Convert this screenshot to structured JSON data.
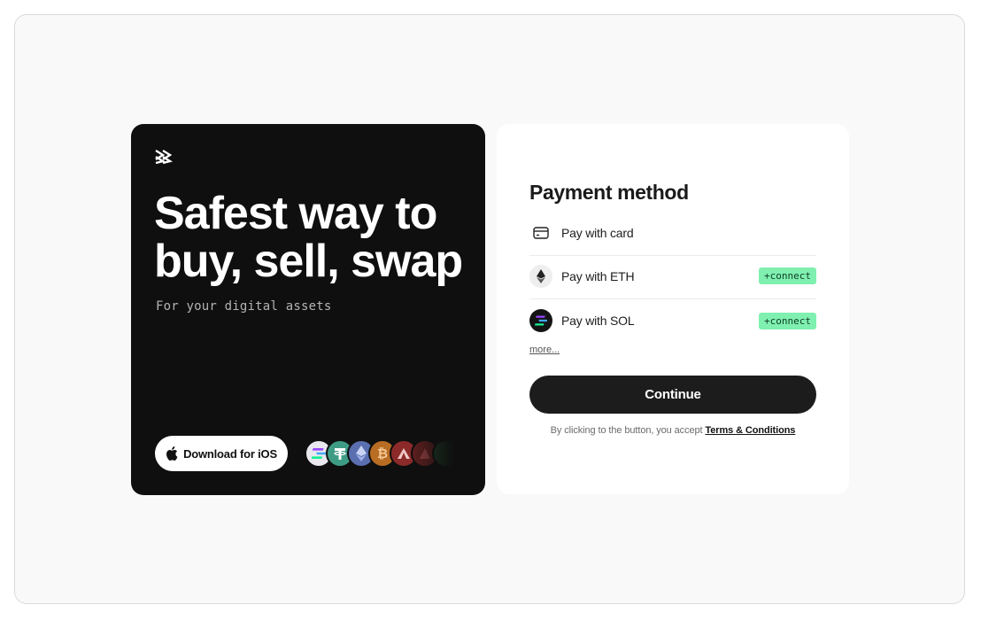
{
  "hero": {
    "title_line1": "Safest way to",
    "title_line2": "buy, sell, swap",
    "subtitle": "For your digital assets",
    "download_button_label": "Download for iOS",
    "logo_icon": "double-chevron-logo-icon",
    "coins": [
      {
        "name": "solana-icon",
        "color": "#e8e8ee"
      },
      {
        "name": "tether-icon",
        "color": "#3f9c84"
      },
      {
        "name": "ethereum-icon",
        "color": "#5a6fb0"
      },
      {
        "name": "bitcoin-icon",
        "color": "#b86d22"
      },
      {
        "name": "avalanche-icon",
        "color": "#8c2a2a"
      },
      {
        "name": "arbitrum-icon",
        "color": "#5a1e1e"
      },
      {
        "name": "faded-coin-icon",
        "color": "#1e3a26"
      }
    ]
  },
  "payment": {
    "title": "Payment method",
    "methods": [
      {
        "label": "Pay with card",
        "icon": "credit-card-icon",
        "connect": ""
      },
      {
        "label": "Pay with ETH",
        "icon": "ethereum-icon",
        "connect": "+connect"
      },
      {
        "label": "Pay with SOL",
        "icon": "solana-icon",
        "connect": "+connect"
      }
    ],
    "more_label": "more...",
    "continue_label": "Continue",
    "terms_text": "By clicking to the button, you accept",
    "terms_link": "Terms & Conditions"
  },
  "colors": {
    "hero_bg": "#0f0f0f",
    "accent_connect": "#7ff0b0",
    "button_dark": "#1c1c1c"
  }
}
